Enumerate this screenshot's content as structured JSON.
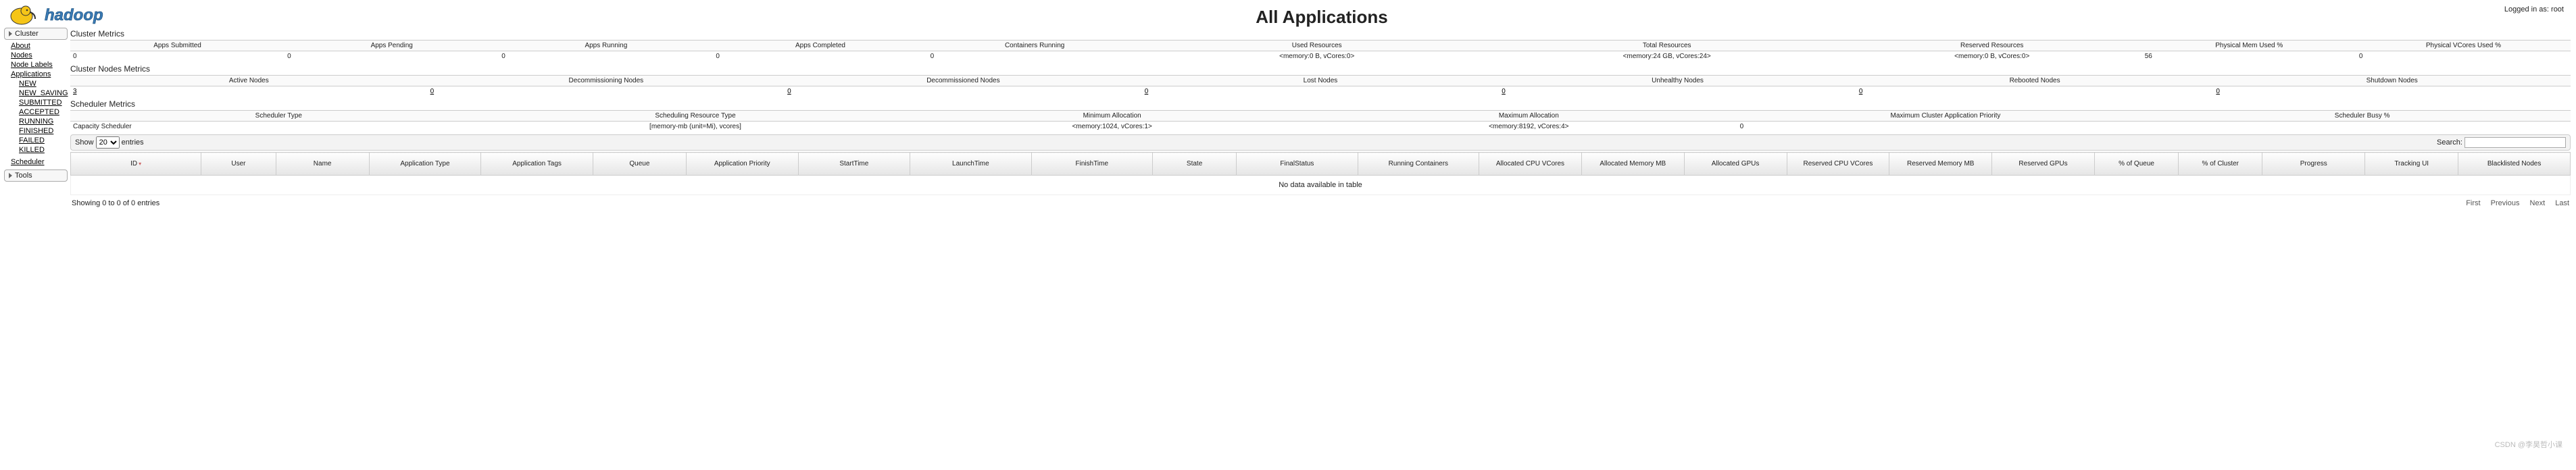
{
  "header": {
    "logo_text": "hadoop",
    "page_title": "All Applications",
    "login_prefix": "Logged in as: ",
    "login_user": "root"
  },
  "sidebar": {
    "section_cluster": "Cluster",
    "section_tools": "Tools",
    "items": {
      "about": "About",
      "nodes": "Nodes",
      "node_labels": "Node Labels",
      "applications": "Applications",
      "scheduler": "Scheduler"
    },
    "app_states": {
      "new": "NEW",
      "new_saving": "NEW_SAVING",
      "submitted": "SUBMITTED",
      "accepted": "ACCEPTED",
      "running": "RUNNING",
      "finished": "FINISHED",
      "failed": "FAILED",
      "killed": "KILLED"
    }
  },
  "sections": {
    "cluster_metrics": "Cluster Metrics",
    "cluster_nodes_metrics": "Cluster Nodes Metrics",
    "scheduler_metrics": "Scheduler Metrics"
  },
  "cluster_metrics": {
    "headers": {
      "apps_submitted": "Apps Submitted",
      "apps_pending": "Apps Pending",
      "apps_running": "Apps Running",
      "apps_completed": "Apps Completed",
      "containers_running": "Containers Running",
      "used_resources": "Used Resources",
      "total_resources": "Total Resources",
      "reserved_resources": "Reserved Resources",
      "phys_mem_used": "Physical Mem Used %",
      "phys_vcores_used": "Physical VCores Used %"
    },
    "values": {
      "apps_submitted": "0",
      "apps_pending": "0",
      "apps_running": "0",
      "apps_completed": "0",
      "containers_running": "0",
      "used_resources": "<memory:0 B, vCores:0>",
      "total_resources": "<memory:24 GB, vCores:24>",
      "reserved_resources": "<memory:0 B, vCores:0>",
      "phys_mem_used": "56",
      "phys_vcores_used": "0"
    }
  },
  "nodes_metrics": {
    "headers": {
      "active": "Active Nodes",
      "decommissioning": "Decommissioning Nodes",
      "decommissioned": "Decommissioned Nodes",
      "lost": "Lost Nodes",
      "unhealthy": "Unhealthy Nodes",
      "rebooted": "Rebooted Nodes",
      "shutdown": "Shutdown Nodes"
    },
    "values": {
      "active": "3",
      "decommissioning": "0",
      "decommissioned": "0",
      "lost": "0",
      "unhealthy": "0",
      "rebooted": "0",
      "shutdown": "0"
    }
  },
  "scheduler_metrics": {
    "headers": {
      "type": "Scheduler Type",
      "resource_type": "Scheduling Resource Type",
      "min_alloc": "Minimum Allocation",
      "max_alloc": "Maximum Allocation",
      "max_priority": "Maximum Cluster Application Priority",
      "busy": "Scheduler Busy %"
    },
    "values": {
      "type": "Capacity Scheduler",
      "resource_type": "[memory-mb (unit=Mi), vcores]",
      "min_alloc": "<memory:1024, vCores:1>",
      "max_alloc": "<memory:8192, vCores:4>",
      "max_priority": "0",
      "busy": ""
    }
  },
  "datatable": {
    "show_label_pre": "Show ",
    "show_value": "20",
    "show_label_post": " entries",
    "search_label": "Search:",
    "empty": "No data available in table",
    "info": "Showing 0 to 0 of 0 entries",
    "pager": {
      "first": "First",
      "prev": "Previous",
      "next": "Next",
      "last": "Last"
    },
    "columns": {
      "id": "ID",
      "user": "User",
      "name": "Name",
      "app_type": "Application Type",
      "app_tags": "Application Tags",
      "queue": "Queue",
      "app_priority": "Application Priority",
      "start_time": "StartTime",
      "launch_time": "LaunchTime",
      "finish_time": "FinishTime",
      "state": "State",
      "final_status": "FinalStatus",
      "running_containers": "Running Containers",
      "alloc_cpu": "Allocated CPU VCores",
      "alloc_mem": "Allocated Memory MB",
      "alloc_gpus": "Allocated GPUs",
      "res_cpu": "Reserved CPU VCores",
      "res_mem": "Reserved Memory MB",
      "res_gpus": "Reserved GPUs",
      "pct_queue": "% of Queue",
      "pct_cluster": "% of Cluster",
      "progress": "Progress",
      "tracking_ui": "Tracking UI",
      "blacklisted": "Blacklisted Nodes"
    }
  },
  "watermark": "CSDN @李昊哲小课"
}
